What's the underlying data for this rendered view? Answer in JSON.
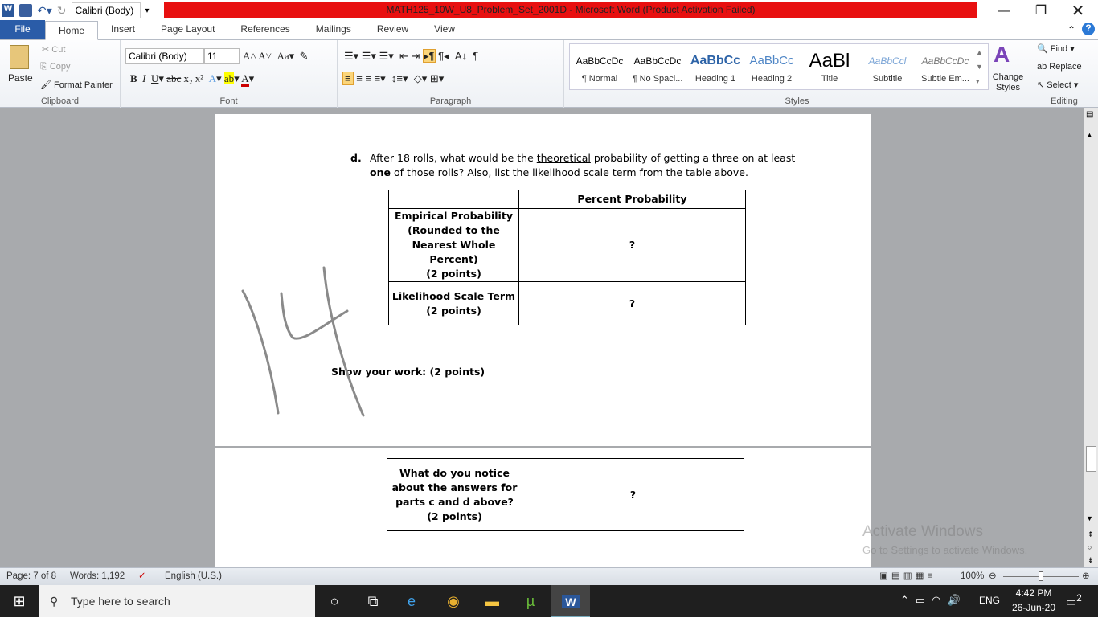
{
  "titlebar": {
    "title": "MATH125_10W_U8_Problem_Set_2001D  -  Microsoft Word (Product Activation Failed)",
    "qat_font": "Calibri (Body)"
  },
  "tabs": [
    "File",
    "Home",
    "Insert",
    "Page Layout",
    "References",
    "Mailings",
    "Review",
    "View"
  ],
  "ribbon": {
    "clipboard": {
      "paste": "Paste",
      "cut": "Cut",
      "copy": "Copy",
      "format_painter": "Format Painter",
      "label": "Clipboard"
    },
    "font": {
      "name": "Calibri (Body)",
      "size": "11",
      "label": "Font"
    },
    "paragraph": {
      "label": "Paragraph"
    },
    "styles": {
      "items": [
        {
          "sample": "AaBbCcDc",
          "name": "¶ Normal"
        },
        {
          "sample": "AaBbCcDc",
          "name": "¶ No Spaci..."
        },
        {
          "sample": "AaBbCc",
          "name": "Heading 1"
        },
        {
          "sample": "AaBbCc",
          "name": "Heading 2"
        },
        {
          "sample": "AaBl",
          "name": "Title"
        },
        {
          "sample": "AaBbCcl",
          "name": "Subtitle"
        },
        {
          "sample": "AaBbCcDc",
          "name": "Subtle Em..."
        }
      ],
      "change_styles": "Change Styles",
      "label": "Styles"
    },
    "editing": {
      "find": "Find",
      "replace": "Replace",
      "select": "Select",
      "label": "Editing"
    }
  },
  "document": {
    "question_letter": "d.",
    "question_line1_pre": "After 18 rolls, what would be the ",
    "question_line1_link": "theoretical",
    "question_line1_post": " probability of getting a three on at least",
    "question_line2_bold": "one",
    "question_line2_rest": " of those rolls? Also, list the likelihood scale term from the table above.",
    "table1": {
      "header": "Percent Probability",
      "rows": [
        {
          "label": [
            "Empirical Probability",
            "(Rounded to the",
            "Nearest Whole Percent)",
            "(2 points)"
          ],
          "value": "?"
        },
        {
          "label": [
            "Likelihood Scale Term",
            "(2 points)"
          ],
          "value": "?"
        }
      ]
    },
    "handwritten": "14",
    "show_work": "Show your work: (2 points)",
    "table2": {
      "label": [
        "What do you notice",
        "about the answers for",
        "parts c and d above?",
        "(2 points)"
      ],
      "value": "?"
    }
  },
  "watermark": {
    "line1": "Activate Windows",
    "line2": "Go to Settings to activate Windows."
  },
  "statusbar": {
    "page": "Page: 7 of 8",
    "words": "Words: 1,192",
    "language": "English (U.S.)",
    "zoom": "100%",
    "zoom_level": 100
  },
  "taskbar": {
    "search_placeholder": "Type here to search",
    "time": "4:42 PM",
    "date": "26-Jun-20",
    "lang": "ENG",
    "notifications": "2"
  }
}
